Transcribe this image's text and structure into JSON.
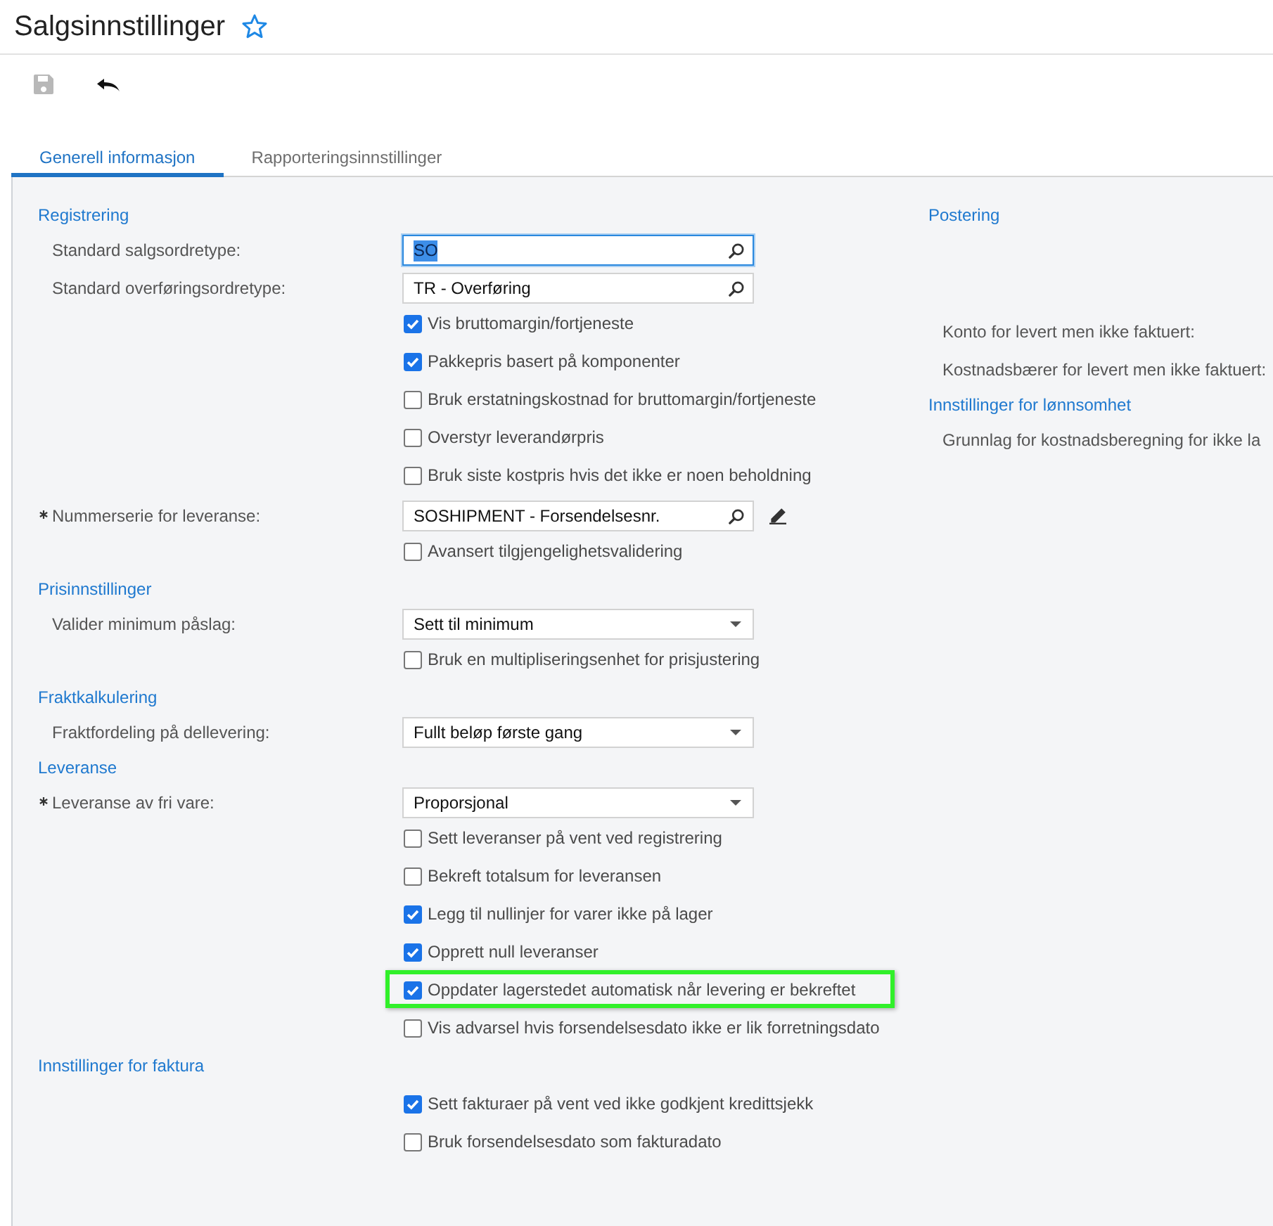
{
  "title": "Salgsinnstillinger",
  "favorite": false,
  "toolbar": [
    {
      "kind": "save",
      "disabled": true
    },
    {
      "kind": "undo",
      "disabled": false
    }
  ],
  "tabs": [
    {
      "label": "Generell informasjon",
      "selected": true
    },
    {
      "label": "Rapporteringsinnstillinger",
      "selected": false
    }
  ],
  "left_sections": [
    {
      "title": "Registrering",
      "rows": [
        {
          "kind": "lookup",
          "label": "Standard salgsordretype:",
          "value": "SO",
          "required": false,
          "focused": true,
          "editable": false
        },
        {
          "kind": "lookup",
          "label": "Standard overføringsordretype:",
          "value": "TR - Overføring",
          "required": false,
          "focused": false,
          "editable": false
        },
        {
          "kind": "checkbox",
          "label": "Vis bruttomargin/fortjeneste",
          "checked": true,
          "highlighted": false
        },
        {
          "kind": "checkbox",
          "label": "Pakkepris basert på komponenter",
          "checked": true,
          "highlighted": false
        },
        {
          "kind": "checkbox",
          "label": "Bruk erstatningskostnad for bruttomargin/fortjeneste",
          "checked": false,
          "highlighted": false
        },
        {
          "kind": "checkbox",
          "label": "Overstyr leverandørpris",
          "checked": false,
          "highlighted": false
        },
        {
          "kind": "checkbox",
          "label": "Bruk siste kostpris hvis det ikke er noen beholdning",
          "checked": false,
          "highlighted": false
        },
        {
          "kind": "lookup",
          "label": "Nummerserie for leveranse:",
          "value": "SOSHIPMENT - Forsendelsesnr.",
          "required": true,
          "focused": false,
          "editable": true
        },
        {
          "kind": "checkbox",
          "label": "Avansert tilgjengelighetsvalidering",
          "checked": false,
          "highlighted": false
        }
      ]
    },
    {
      "title": "Prisinnstillinger",
      "rows": [
        {
          "kind": "select",
          "label": "Valider minimum påslag:",
          "value": "Sett til minimum",
          "required": false
        },
        {
          "kind": "checkbox",
          "label": "Bruk en multipliseringsenhet for prisjustering",
          "checked": false,
          "highlighted": false
        }
      ]
    },
    {
      "title": "Fraktkalkulering",
      "rows": [
        {
          "kind": "select",
          "label": "Fraktfordeling på dellevering:",
          "value": "Fullt beløp første gang",
          "required": false
        }
      ]
    },
    {
      "title": "Leveranse",
      "rows": [
        {
          "kind": "select",
          "label": "Leveranse av fri vare:",
          "value": "Proporsjonal",
          "required": true
        },
        {
          "kind": "checkbox",
          "label": "Sett leveranser på vent ved registrering",
          "checked": false,
          "highlighted": false
        },
        {
          "kind": "checkbox",
          "label": "Bekreft totalsum for leveransen",
          "checked": false,
          "highlighted": false
        },
        {
          "kind": "checkbox",
          "label": "Legg til nullinjer for varer ikke på lager",
          "checked": true,
          "highlighted": false
        },
        {
          "kind": "checkbox",
          "label": "Opprett null leveranser",
          "checked": true,
          "highlighted": false
        },
        {
          "kind": "checkbox",
          "label": "Oppdater lagerstedet automatisk når levering er bekreftet",
          "checked": true,
          "highlighted": true
        },
        {
          "kind": "checkbox",
          "label": "Vis advarsel hvis forsendelsesdato ikke er lik forretningsdato",
          "checked": false,
          "highlighted": false
        }
      ]
    },
    {
      "title": "Innstillinger for faktura",
      "rows": [
        {
          "kind": "checkbox",
          "label": "Sett fakturaer på vent ved ikke godkjent kredittsjekk",
          "checked": true,
          "highlighted": false
        },
        {
          "kind": "checkbox",
          "label": "Bruk forsendelsesdato som fakturadato",
          "checked": false,
          "highlighted": false
        }
      ]
    }
  ],
  "right_sections": [
    {
      "title": "Postering",
      "rows": [
        {
          "label": "Konto for levert men ikke faktuert:"
        },
        {
          "label": "Kostnadsbærer for levert men ikke faktuert:"
        }
      ]
    },
    {
      "title": "Innstillinger for lønnsomhet",
      "rows": [
        {
          "label": "Grunnlag for kostnadsberegning for ikke la"
        }
      ]
    }
  ]
}
